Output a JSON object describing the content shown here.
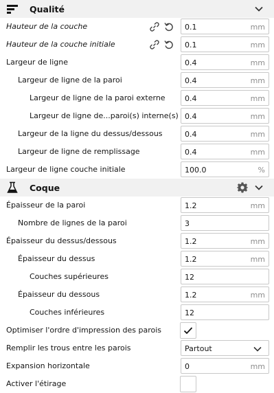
{
  "sections": {
    "quality": {
      "title": "Qualité",
      "icon": "quality-sliders-icon",
      "chevron_icon": "chevron-down-icon"
    },
    "shell": {
      "title": "Coque",
      "icon": "flask-shell-icon",
      "gear_icon": "gear-icon",
      "chevron_icon": "chevron-down-icon"
    }
  },
  "quality_rows": [
    {
      "label": "Hauteur de la couche",
      "value": "0.1",
      "unit": "mm"
    },
    {
      "label": "Hauteur de la couche initiale",
      "value": "0.1",
      "unit": "mm"
    },
    {
      "label": "Largeur de ligne",
      "value": "0.4",
      "unit": "mm"
    },
    {
      "label": "Largeur de ligne de la paroi",
      "value": "0.4",
      "unit": "mm"
    },
    {
      "label": "Largeur de ligne de la paroi externe",
      "value": "0.4",
      "unit": "mm"
    },
    {
      "label": "Largeur de ligne de...paroi(s) interne(s)",
      "value": "0.4",
      "unit": "mm"
    },
    {
      "label": "Largeur de la ligne du dessus/dessous",
      "value": "0.4",
      "unit": "mm"
    },
    {
      "label": "Largeur de ligne de remplissage",
      "value": "0.4",
      "unit": "mm"
    },
    {
      "label": "Largeur de ligne couche initiale",
      "value": "100.0",
      "unit": "%"
    }
  ],
  "shell_rows": [
    {
      "label": "Épaisseur de la paroi",
      "value": "1.2",
      "unit": "mm"
    },
    {
      "label": "Nombre de lignes de la paroi",
      "value": "3",
      "unit": ""
    },
    {
      "label": "Épaisseur du dessus/dessous",
      "value": "1.2",
      "unit": "mm"
    },
    {
      "label": "Épaisseur du dessus",
      "value": "1.2",
      "unit": "mm"
    },
    {
      "label": "Couches supérieures",
      "value": "12",
      "unit": ""
    },
    {
      "label": "Épaisseur du dessous",
      "value": "1.2",
      "unit": "mm"
    },
    {
      "label": "Couches inférieures",
      "value": "12",
      "unit": ""
    },
    {
      "label": "Optimiser l'ordre d'impression des parois",
      "checked": true
    },
    {
      "label": "Remplir les trous entre les parois",
      "selected": "Partout"
    },
    {
      "label": "Expansion horizontale",
      "value": "0",
      "unit": "mm"
    },
    {
      "label": "Activer l'étirage",
      "checked": false
    }
  ],
  "colors": {
    "section_bg": "#f1f1f1",
    "field_border": "#c8c8c8",
    "unit_text": "#8d8d8d",
    "text": "#141414"
  }
}
